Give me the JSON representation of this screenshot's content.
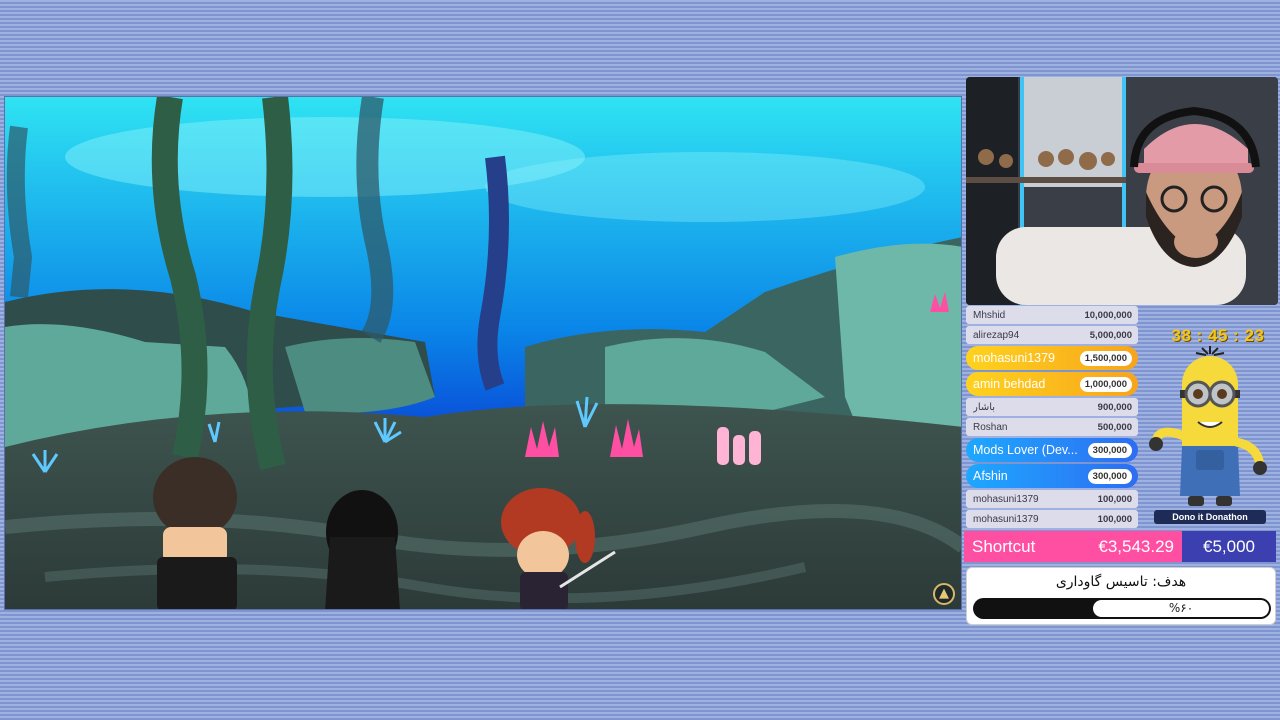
{
  "leaderboard": [
    {
      "name": "Mhshid",
      "amount": "10,000,000",
      "style": "plain"
    },
    {
      "name": "alirezap94",
      "amount": "5,000,000",
      "style": "plain"
    },
    {
      "name": "mohasuni1379",
      "amount": "1,500,000",
      "style": "gold"
    },
    {
      "name": "amin behdad",
      "amount": "1,000,000",
      "style": "gold"
    },
    {
      "name": "باشار",
      "amount": "900,000",
      "style": "plain"
    },
    {
      "name": "Roshan",
      "amount": "500,000",
      "style": "plain"
    },
    {
      "name": "Mods Lover (Dev...",
      "amount": "300,000",
      "style": "blue"
    },
    {
      "name": "Afshin",
      "amount": "300,000",
      "style": "blue"
    },
    {
      "name": "mohasuni1379",
      "amount": "100,000",
      "style": "plain"
    },
    {
      "name": "mohasuni1379",
      "amount": "100,000",
      "style": "plain"
    }
  ],
  "timer": "38 : 45 : 23",
  "mascot_label": "Dono it Donathon",
  "totals": {
    "label": "Shortcut",
    "raised": "€3,543.29",
    "target": "€5,000"
  },
  "goal": {
    "title": "هدف: تاسیس گاوداری",
    "percent_text": "%۶۰",
    "progress": 0.6
  },
  "game": {
    "corner_icon": "witch-hat-icon"
  },
  "colors": {
    "pink": "#ff4fa3",
    "gold": "#f5c518",
    "blue": "#2e6df2",
    "navy": "#3b3fb0"
  }
}
